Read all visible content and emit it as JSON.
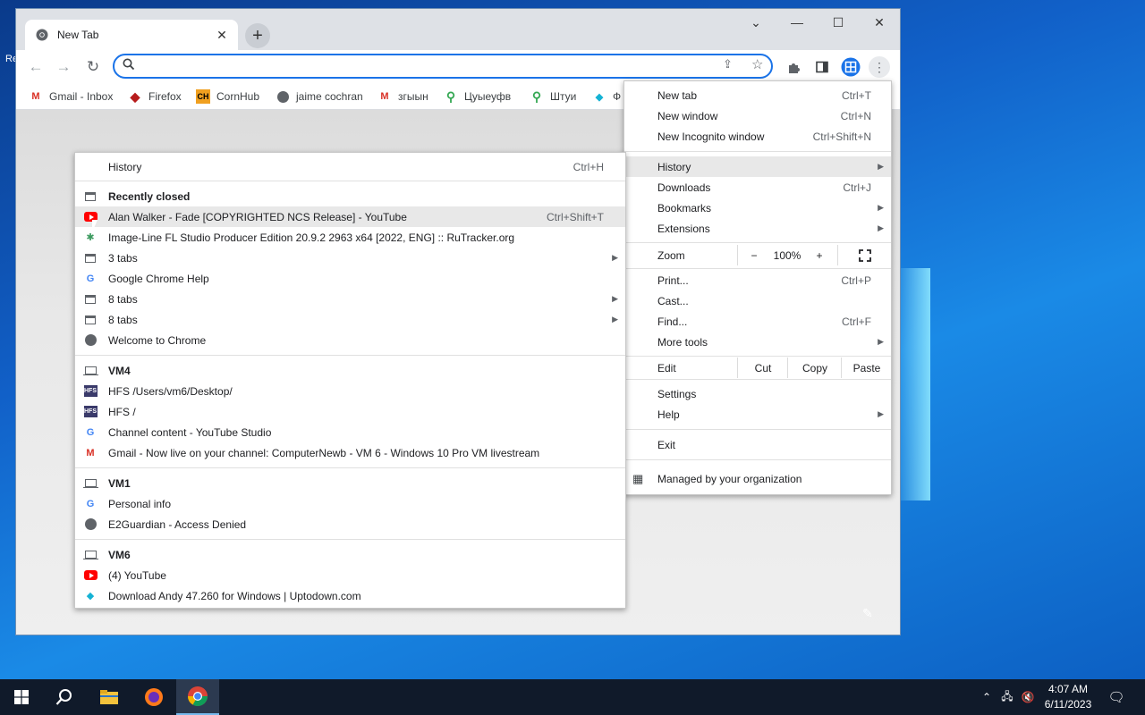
{
  "desktop": {
    "edge_text": "Re"
  },
  "tab": {
    "title": "New Tab",
    "close": "✕"
  },
  "window_controls": {
    "dropdown": "⌄",
    "minimize": "—",
    "maximize": "☐",
    "close": "✕"
  },
  "omnibox": {
    "value": "",
    "placeholder": ""
  },
  "bookmarks": [
    {
      "label": "Gmail - Inbox",
      "icon": "gmail-icon"
    },
    {
      "label": "Firefox",
      "icon": "firefox-icon"
    },
    {
      "label": "CornHub",
      "icon": "cornhub-icon"
    },
    {
      "label": "jaime cochran",
      "icon": "globe-icon"
    },
    {
      "label": "згыын",
      "icon": "gmail-icon"
    },
    {
      "label": "Цуыеуфв",
      "icon": "maps-pin-icon"
    },
    {
      "label": "Штуи",
      "icon": "maps-pin-icon"
    },
    {
      "label": "Ф",
      "icon": "uptodown-icon"
    }
  ],
  "menu": {
    "new_tab": {
      "label": "New tab",
      "shortcut": "Ctrl+T"
    },
    "new_window": {
      "label": "New window",
      "shortcut": "Ctrl+N"
    },
    "new_incognito": {
      "label": "New Incognito window",
      "shortcut": "Ctrl+Shift+N"
    },
    "history": {
      "label": "History"
    },
    "downloads": {
      "label": "Downloads",
      "shortcut": "Ctrl+J"
    },
    "bookmarks": {
      "label": "Bookmarks"
    },
    "extensions": {
      "label": "Extensions"
    },
    "zoom": {
      "label": "Zoom",
      "minus": "−",
      "value": "100%",
      "plus": "+"
    },
    "print": {
      "label": "Print...",
      "shortcut": "Ctrl+P"
    },
    "cast": {
      "label": "Cast..."
    },
    "find": {
      "label": "Find...",
      "shortcut": "Ctrl+F"
    },
    "more_tools": {
      "label": "More tools"
    },
    "edit": {
      "label": "Edit",
      "cut": "Cut",
      "copy": "Copy",
      "paste": "Paste"
    },
    "settings": {
      "label": "Settings"
    },
    "help": {
      "label": "Help"
    },
    "exit": {
      "label": "Exit"
    },
    "managed": {
      "label": "Managed by your organization"
    }
  },
  "history_menu": {
    "history": {
      "label": "History",
      "shortcut": "Ctrl+H"
    },
    "recently_closed": "Recently closed",
    "recent": [
      {
        "label": "Alan Walker - Fade [COPYRIGHTED NCS Release] - YouTube",
        "shortcut": "Ctrl+Shift+T",
        "icon": "youtube-icon"
      },
      {
        "label": "Image-Line FL Studio Producer Edition 20.9.2 2963 x64 [2022, ENG] :: RuTracker.org",
        "icon": "rutracker-icon"
      },
      {
        "label": "3 tabs",
        "icon": "window-icon"
      },
      {
        "label": "Google Chrome Help",
        "icon": "google-icon"
      },
      {
        "label": "8 tabs",
        "icon": "window-icon"
      },
      {
        "label": "8 tabs",
        "icon": "window-icon"
      },
      {
        "label": "Welcome to Chrome",
        "icon": "globe-icon"
      }
    ],
    "devices": [
      {
        "name": "VM4",
        "items": [
          {
            "label": "HFS /Users/vm6/Desktop/",
            "icon": "hfs-icon"
          },
          {
            "label": "HFS /",
            "icon": "hfs-icon"
          },
          {
            "label": "Channel content - YouTube Studio",
            "icon": "google-icon"
          },
          {
            "label": "Gmail - Now live on your channel: ComputerNewb - VM 6 - Windows 10 Pro VM livestream",
            "icon": "gmail-icon"
          }
        ]
      },
      {
        "name": "VM1",
        "items": [
          {
            "label": "Personal info",
            "icon": "google-icon"
          },
          {
            "label": "E2Guardian - Access Denied",
            "icon": "globe-icon"
          }
        ]
      },
      {
        "name": "VM6",
        "items": [
          {
            "label": "(4) YouTube",
            "icon": "youtube-icon"
          },
          {
            "label": "Download Andy 47.260 for Windows | Uptodown.com",
            "icon": "uptodown-icon"
          }
        ]
      }
    ]
  },
  "taskbar": {
    "clock_time": "4:07 AM",
    "clock_date": "6/11/2023"
  }
}
